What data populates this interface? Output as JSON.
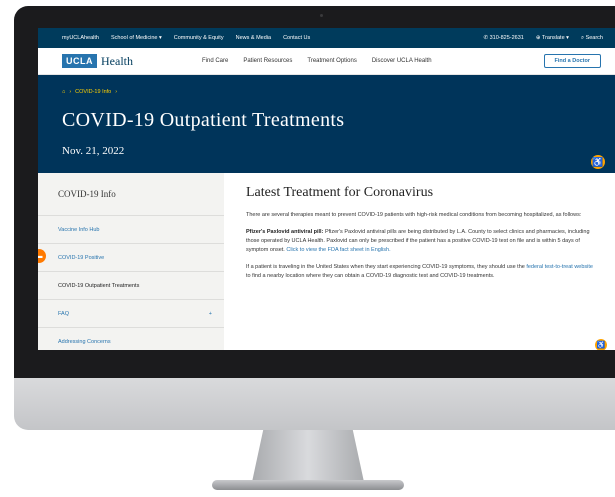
{
  "utility_bar": {
    "links": [
      "myUCLAhealth",
      "School of Medicine ▾",
      "Community & Equity",
      "News & Media",
      "Contact Us"
    ],
    "phone": "310-825-2631",
    "translate": "Translate ▾",
    "search": "Search"
  },
  "header": {
    "logo_ucla": "UCLA",
    "logo_health": "Health",
    "nav": [
      "Find Care",
      "Patient Resources",
      "Treatment Options",
      "Discover UCLA Health"
    ],
    "cta": "Find a Doctor"
  },
  "hero": {
    "breadcrumb": "COVID-19 Info",
    "title": "COVID-19 Outpatient Treatments",
    "date": "Nov. 21, 2022"
  },
  "sidebar": {
    "title": "COVID-19 Info",
    "items": [
      {
        "label": "Vaccine Info Hub"
      },
      {
        "label": "COVID-19 Positive"
      },
      {
        "label": "COVID-19 Outpatient Treatments"
      },
      {
        "label": "FAQ",
        "expand": "+"
      },
      {
        "label": "Addressing Concerns"
      }
    ]
  },
  "main": {
    "heading": "Latest Treatment for Coronavirus",
    "intro": "There are several therapies meant to prevent COVID-19 patients with high-risk medical conditions from becoming hospitalized, as follows:",
    "paxlovid_title": "Pfizer's Paxlovid antiviral pill:",
    "paxlovid_body": " Pfizer's Paxlovid antiviral pills are being distributed by L.A. County to select clinics and pharmacies, including those operated by UCLA Health. Paxlovid can only be prescribed if the patient has a positive COVID-19 test on file and is within 5 days of symptom onset. ",
    "paxlovid_link": "Click to view the FDA fact sheet in English.",
    "travel_body_1": "If a patient is traveling in the United States when they start experiencing COVID-19 symptoms, they should use the ",
    "travel_link": "federal test-to-treat website",
    "travel_body_2": " to find a nearby location where they can obtain a COVID-19 diagnostic test and COVID-19 treatments."
  },
  "icons": {
    "phone": "phone-icon",
    "globe": "globe-icon",
    "search": "search-icon",
    "home": "home-icon",
    "accessibility": "accessibility-icon",
    "chat": "chat-icon"
  },
  "colors": {
    "brand_blue": "#2774ae",
    "dark_blue": "#00345a",
    "accent_yellow": "#ffd100",
    "accent_orange": "#ffa400"
  }
}
